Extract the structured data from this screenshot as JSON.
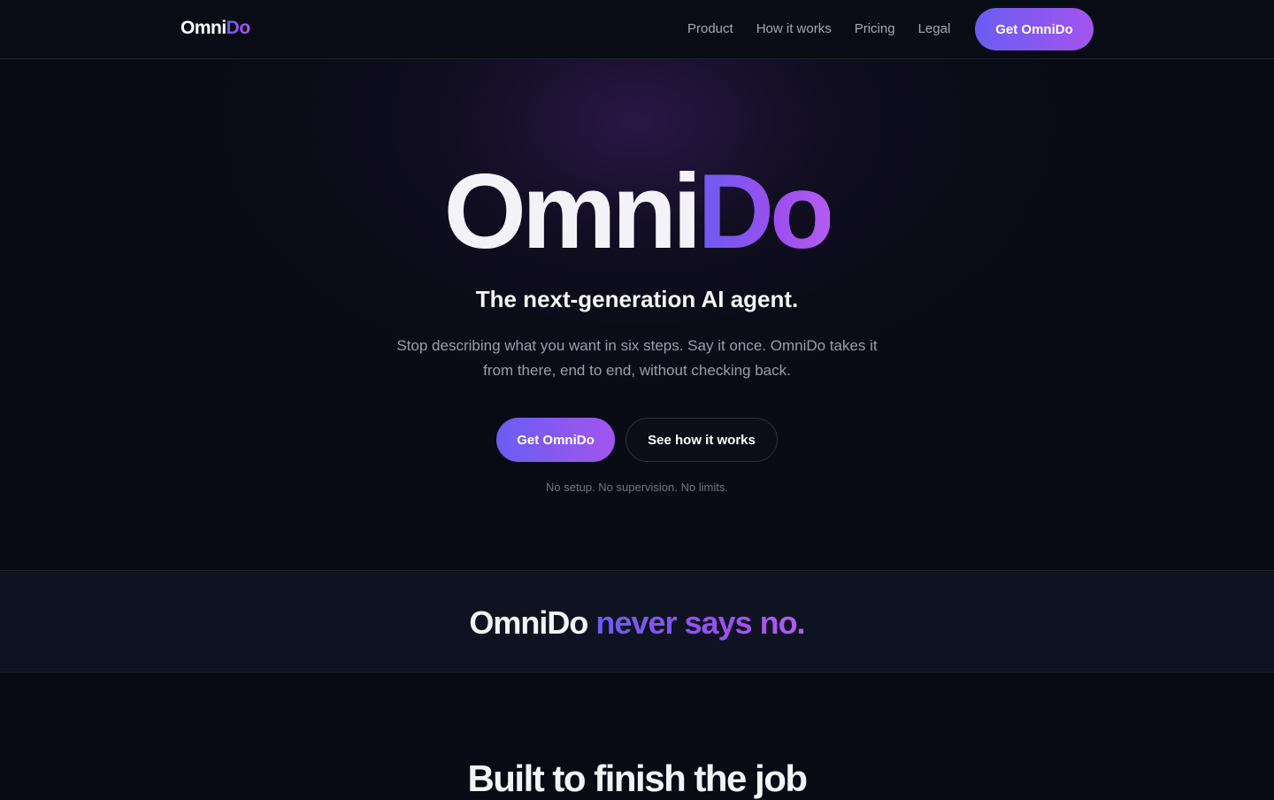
{
  "nav": {
    "logo_part1": "Omni",
    "logo_part2": "Do",
    "links": [
      "Product",
      "How it works",
      "Pricing",
      "Legal"
    ],
    "cta_label": "Get OmniDo"
  },
  "hero": {
    "title_part1": "Omni",
    "title_part2": "Do",
    "subtitle": "The next-generation AI agent.",
    "description": "Stop describing what you want in six steps. Say it once. OmniDo takes it from there, end to end, without checking back.",
    "primary_button": "Get OmniDo",
    "secondary_button": "See how it works",
    "note": "No setup. No supervision. No limits."
  },
  "band": {
    "title_part1": "OmniDo ",
    "title_part2": "never says no."
  },
  "section2": {
    "title": "Built to finish the job"
  },
  "colors": {
    "background": "#090b14",
    "accent_start": "#6a5df2",
    "accent_end": "#a255ee",
    "band_background": "#0f1220"
  }
}
